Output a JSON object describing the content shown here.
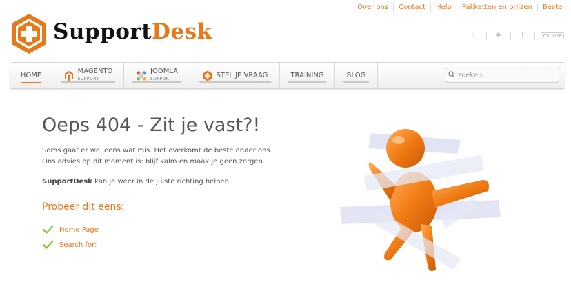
{
  "toplinks": [
    "Over ons",
    "Contact",
    "Help",
    "Pakketten en prijzen",
    "Bestel"
  ],
  "logo": {
    "part1": "Support",
    "part2": "Desk"
  },
  "social": {
    "youtube_label": "YouTube"
  },
  "nav": {
    "home": "HOME",
    "magento": {
      "label": "MAGENTO",
      "sub": "SUPPORT"
    },
    "joomla": {
      "label": "JOOMLA",
      "sub": "SUPPORT"
    },
    "ask": "STEL JE VRAAG",
    "training": "TRAINING",
    "blog": "BLOG"
  },
  "search": {
    "placeholder": "zoeken..."
  },
  "content": {
    "title": "Oeps 404 - Zit je vast?!",
    "line1": "Soms gaat er wel eens wat mis. Het overkomt de beste onder ons.",
    "line2": "Ons advies op dit moment is: blijf kalm en maak je geen zorgen.",
    "brand": "SupportDesk",
    "line3": " kan je weer in de juiste richting helpen.",
    "try_heading": "Probeer dit eens:",
    "links": [
      "Home Page",
      "Search for:"
    ]
  },
  "colors": {
    "accent": "#e8791a",
    "text": "#555555",
    "check": "#7cc22a"
  }
}
